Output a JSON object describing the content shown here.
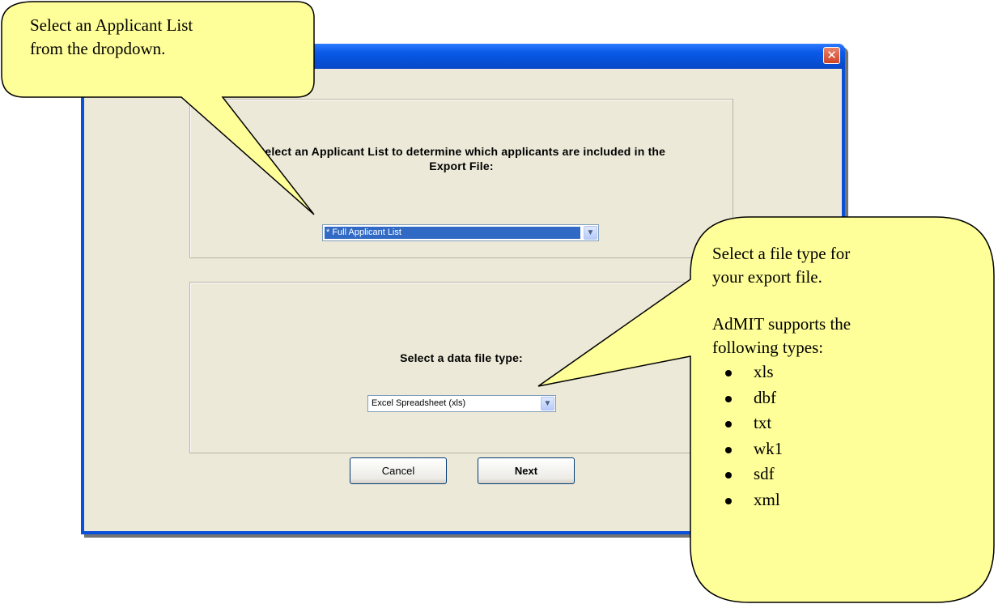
{
  "dialog": {
    "close_glyph": "✕",
    "list_prompt": "Select an Applicant List to determine which applicants are included in the Export File:",
    "list_value": "* Full Applicant List",
    "filetype_prompt": "Select a data file type:",
    "filetype_value": "Excel Spreadsheet (xls)",
    "dropdown_arrow": "▼",
    "cancel_label": "Cancel",
    "next_label": "Next"
  },
  "callouts": {
    "applicant_list": {
      "line1": "Select an Applicant List",
      "line2": "from the dropdown."
    },
    "file_type": {
      "line1": "Select a file type for",
      "line2": "your export file.",
      "line3": "AdMIT  supports the",
      "line4": "following types:",
      "types": [
        "xls",
        "dbf",
        "txt",
        "wk1",
        "sdf",
        "xml"
      ]
    }
  },
  "colors": {
    "callout_fill": "#ffff99",
    "titlebar": "#0a5ae8",
    "selection": "#316ac5"
  }
}
